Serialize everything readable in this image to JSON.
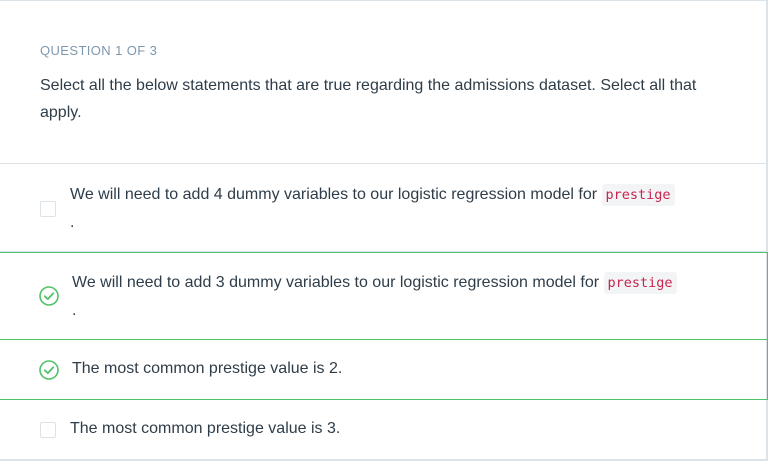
{
  "question": {
    "number_label": "QUESTION 1 OF 3",
    "prompt": "Select all the below statements that are true regarding the admissions dataset. Select all that apply."
  },
  "options": [
    {
      "text": "We will need to add 4 dummy variables to our logistic regression model for ",
      "code": "prestige",
      "suffix": ".",
      "checked": false
    },
    {
      "text": "We will need to add 3 dummy variables to our logistic regression model for ",
      "code": "prestige",
      "suffix": ".",
      "checked": true
    },
    {
      "text": "The most common prestige value is 2.",
      "checked": true
    },
    {
      "text": "The most common prestige value is 3.",
      "checked": false
    }
  ],
  "colors": {
    "accent_green": "#50c26c",
    "border_gray": "#dbe2e8",
    "code_red": "#c7254e",
    "label_gray": "#7d97ad"
  },
  "icons": {
    "checked": "check-circle-icon",
    "unchecked": "empty-checkbox"
  }
}
